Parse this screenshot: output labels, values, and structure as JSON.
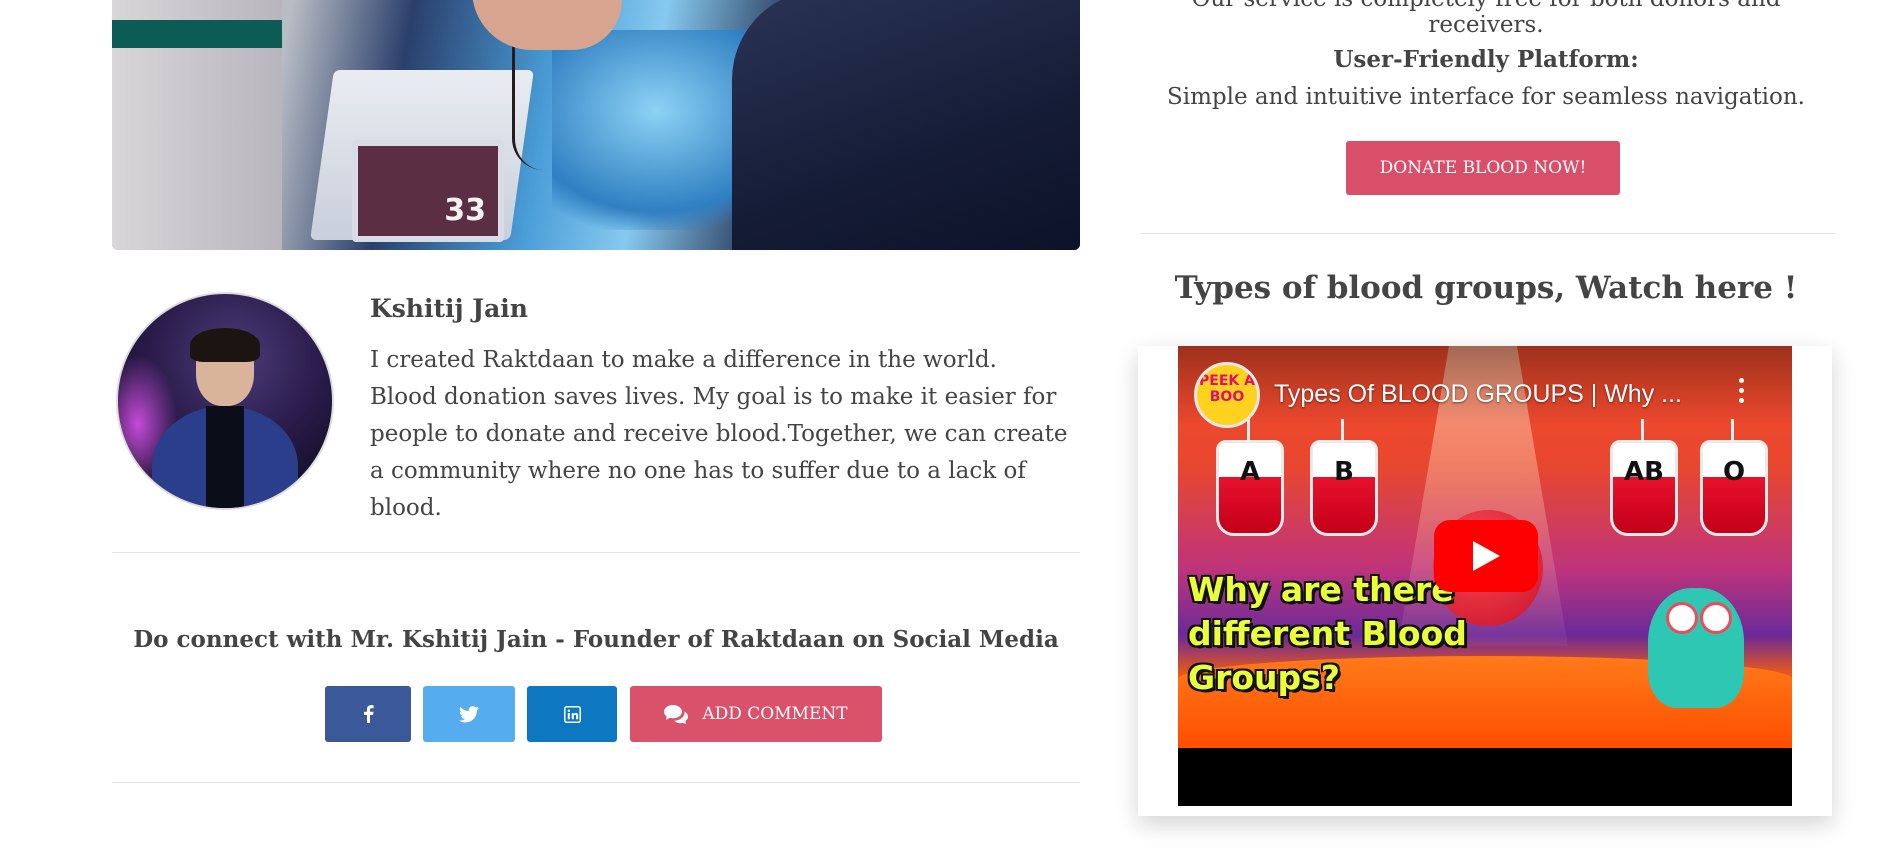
{
  "features": {
    "cut_line": "Our service is completely free for both donors and receivers.",
    "title": "User-Friendly Platform:",
    "description": "Simple and intuitive interface for seamless navigation."
  },
  "donate_button": "DONATE BLOOD NOW!",
  "author": {
    "name": "Kshitij Jain",
    "bio": "I created Raktdaan to make a difference in the world. Blood donation saves lives. My goal is to make it easier for people to donate and receive blood.Together, we can create a community where no one has to suffer due to a lack of blood."
  },
  "connect": {
    "title": "Do connect with Mr. Kshitij Jain - Founder of Raktdaan on Social Media",
    "comment_label": "ADD COMMENT",
    "icons": [
      "facebook-icon",
      "twitter-icon",
      "linkedin-icon",
      "comments-icon"
    ]
  },
  "video_section": {
    "heading": "Types of blood groups, Watch here !",
    "video_title": "Types Of BLOOD GROUPS | Why ...",
    "channel_logo_text": "PEEK A BOO",
    "thumbnail_text": "Why are there different Blood Groups?",
    "bag_labels": [
      "A",
      "B",
      "AB",
      "O"
    ],
    "colors": {
      "play_button": "#ff0000",
      "headline": "#e8ff3a"
    }
  },
  "colors": {
    "accent": "#d9526a",
    "facebook": "#3b5998",
    "twitter": "#55acee",
    "linkedin": "#0e77c2",
    "text": "#444444"
  }
}
